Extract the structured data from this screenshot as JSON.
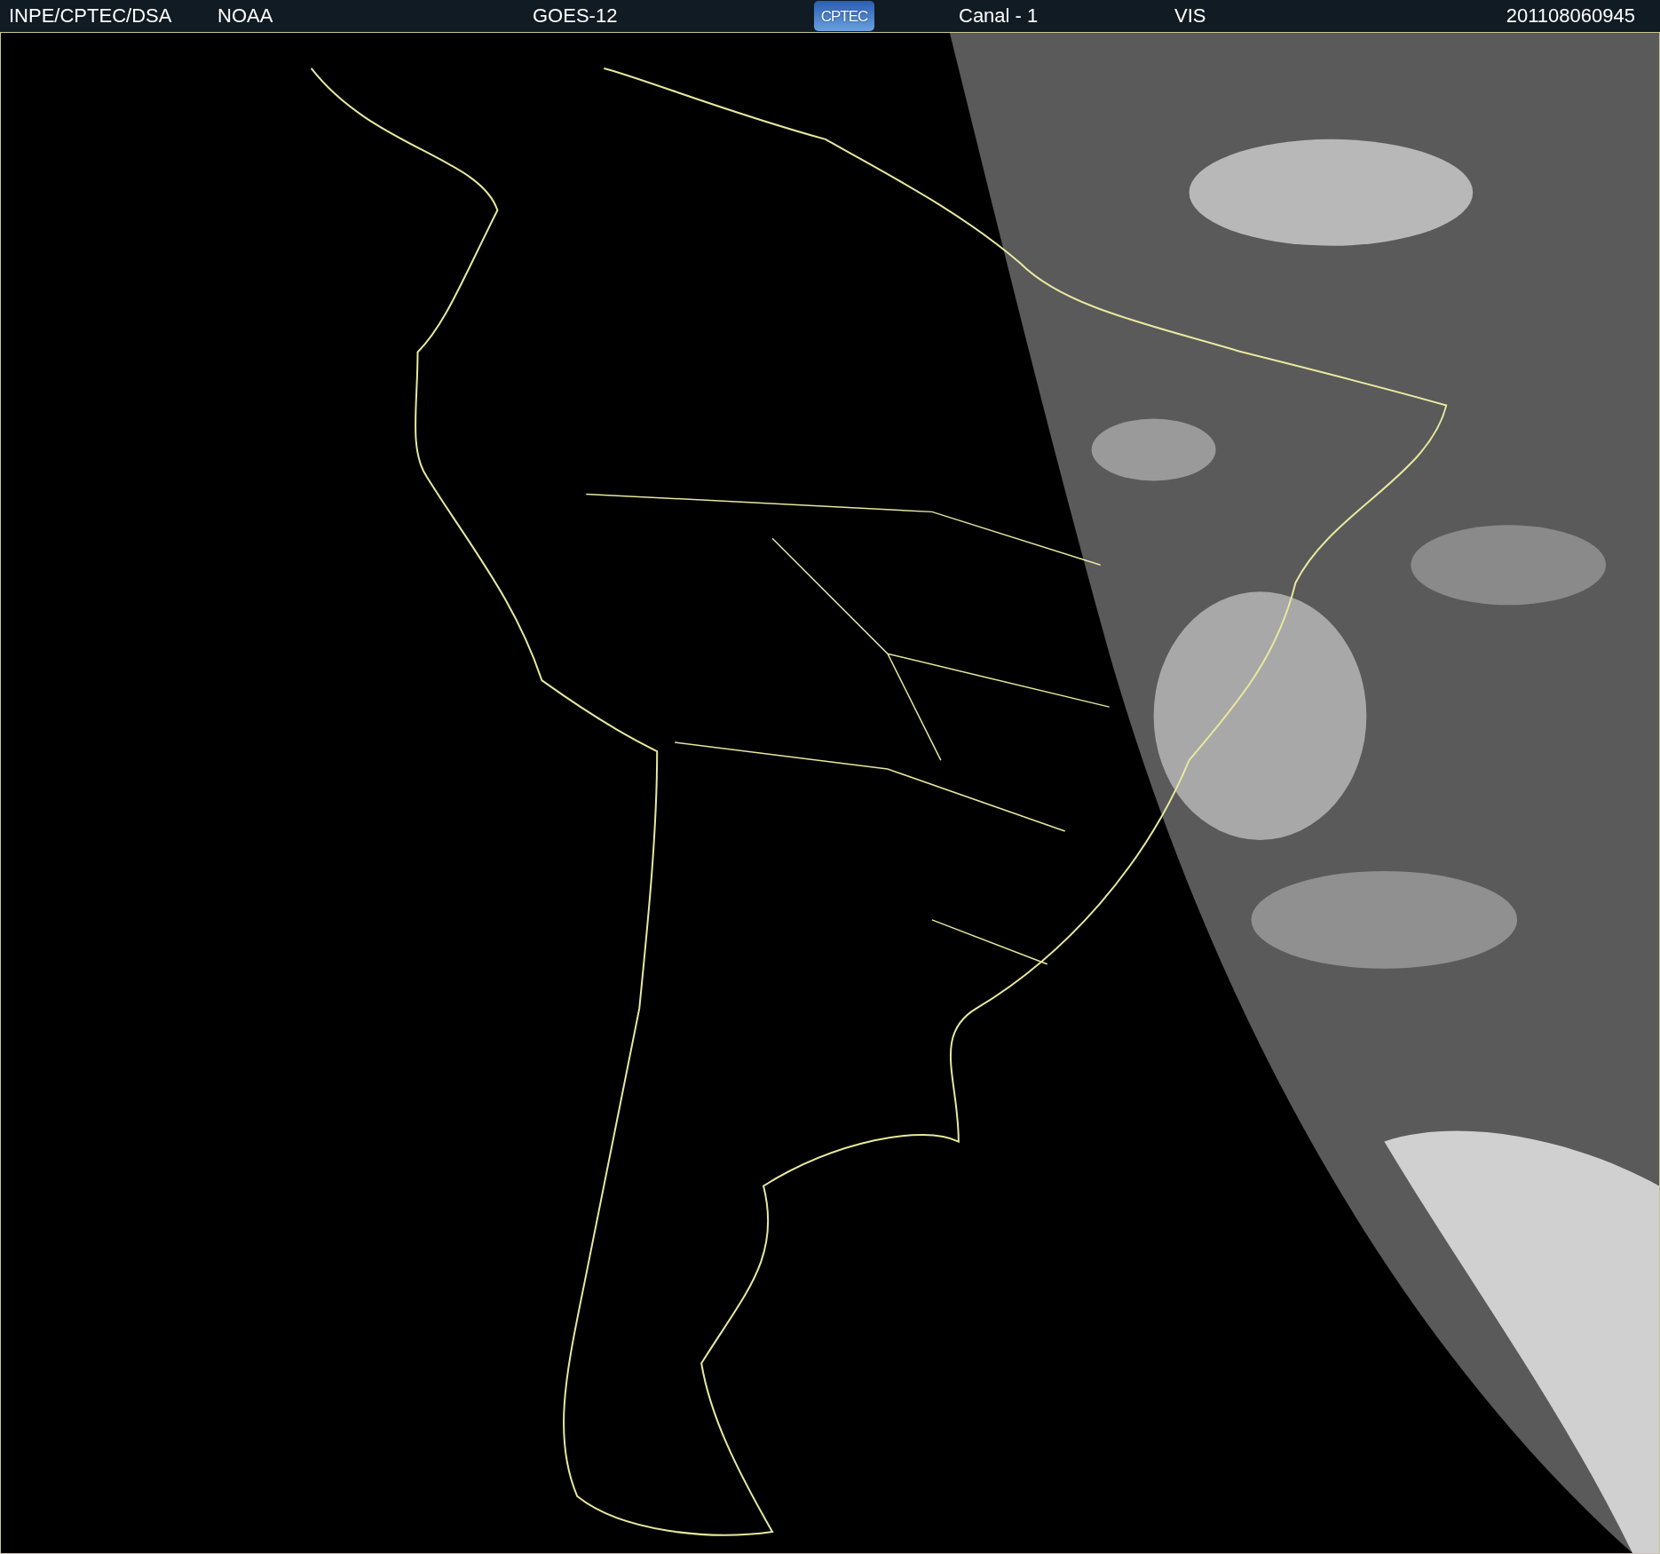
{
  "header": {
    "source": "INPE/CPTEC/DSA",
    "agency": "NOAA",
    "satellite": "GOES-12",
    "logo": "CPTEC",
    "channel": "Canal - 1",
    "band": "VIS",
    "timestamp": "201108060945"
  }
}
